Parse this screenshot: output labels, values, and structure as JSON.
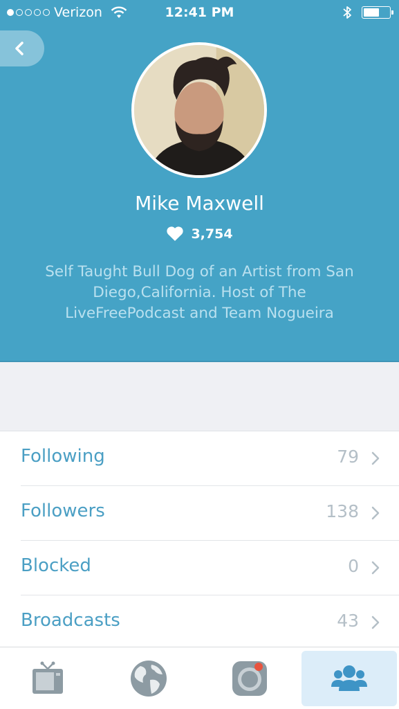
{
  "status_bar": {
    "signal_dots_filled": 1,
    "signal_dots_total": 5,
    "carrier": "Verizon",
    "time": "12:41 PM",
    "battery_level": 0.6
  },
  "header": {
    "back_icon": "chevron-left-icon",
    "avatar_icon": "profile-photo",
    "name": "Mike Maxwell",
    "likes_icon": "heart-icon",
    "likes_count": "3,754",
    "bio": "Self Taught Bull Dog of an Artist from San Diego,California. Host of The LiveFreePodcast and Team Nogueira"
  },
  "stats": [
    {
      "label": "Following",
      "count": "79"
    },
    {
      "label": "Followers",
      "count": "138"
    },
    {
      "label": "Blocked",
      "count": "0"
    },
    {
      "label": "Broadcasts",
      "count": "43"
    }
  ],
  "tab_bar": {
    "tabs": [
      {
        "icon": "tv-icon",
        "active": false
      },
      {
        "icon": "globe-icon",
        "active": false
      },
      {
        "icon": "camera-icon",
        "active": false
      },
      {
        "icon": "people-icon",
        "active": true
      }
    ]
  },
  "colors": {
    "header_bg": "#45a3c6",
    "accent": "#4b9fc4",
    "count_gray": "#b4bfc7",
    "active_tab_bg": "#dcedf9",
    "page_bg": "#eff0f4"
  }
}
